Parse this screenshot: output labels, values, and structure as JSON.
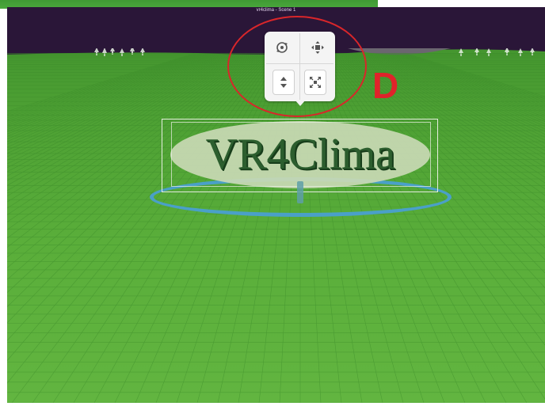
{
  "window": {
    "title": "vr4clima - Scene 1"
  },
  "scene": {
    "logo_text": "VR4Clima"
  },
  "annotation": {
    "label": "D",
    "color": "#e0232a"
  },
  "toolbar": {
    "tools": [
      {
        "name": "rotate",
        "icon": "rotate-icon"
      },
      {
        "name": "move",
        "icon": "move-icon"
      },
      {
        "name": "move-vertical",
        "icon": "up-down-arrows-icon"
      },
      {
        "name": "scale",
        "icon": "scale-icon"
      }
    ]
  },
  "colors": {
    "title_bar": "#2a1638",
    "ground": "#5aae3a",
    "selection_ring": "#4aa0c8"
  }
}
